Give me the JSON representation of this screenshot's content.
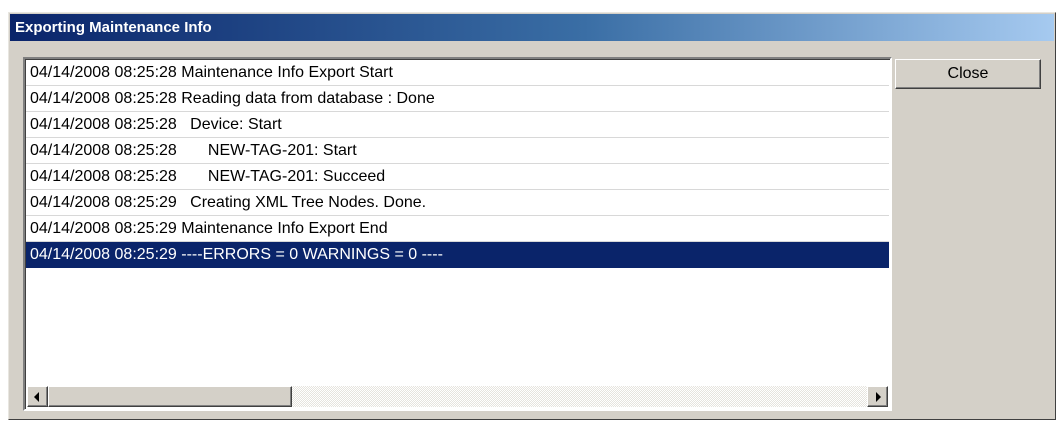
{
  "window": {
    "title": "Exporting Maintenance Info"
  },
  "log": {
    "selected_index": 7,
    "rows": [
      "04/14/2008 08:25:28 Maintenance Info Export Start",
      "04/14/2008 08:25:28 Reading data from database : Done",
      "04/14/2008 08:25:28   Device: Start",
      "04/14/2008 08:25:28       NEW-TAG-201: Start",
      "04/14/2008 08:25:28       NEW-TAG-201: Succeed",
      "04/14/2008 08:25:29   Creating XML Tree Nodes. Done.",
      "04/14/2008 08:25:29 Maintenance Info Export End",
      "04/14/2008 08:25:29 ----ERRORS = 0 WARNINGS = 0 ----"
    ]
  },
  "buttons": {
    "close_label": "Close"
  },
  "scrollbar": {
    "position": 0
  }
}
